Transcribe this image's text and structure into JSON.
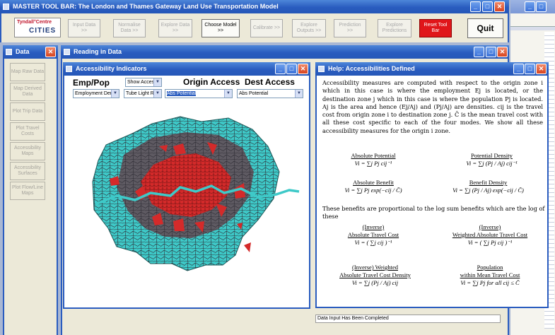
{
  "master": {
    "title": "MASTER TOOL BAR: The London and Thames Gateway Land Use Transportation Model",
    "logo_top": "Tyndall°Centre",
    "logo_bottom": "CITIES",
    "buttons": [
      "Input Data >>",
      "Normalise Data >>",
      "Explore Data >>",
      "Choose Model >>",
      "Calibrate >>",
      "Explore Outputs >>",
      "Prediction >>",
      "Explore Predictions"
    ],
    "reset": "Reset Tool Bar",
    "quit": "Quit"
  },
  "data_panel": {
    "title": "Data",
    "buttons": [
      "Map Raw Data",
      "Map Derived Data",
      "Plot Trip Data",
      "Plot Travel Costs",
      "Accessibility Maps",
      "Accessibility Surfaces",
      "Plot Flow/Line Maps"
    ]
  },
  "reading": {
    "title": "Reading in Data",
    "status": "Data Input Has Been Completed"
  },
  "access": {
    "title": "Accessibility Indicators",
    "emp_pop": "Emp/Pop",
    "origin": "Origin Access",
    "dest": "Dest Access",
    "sel_show": "Show Access",
    "sel_emp": "Employment Dens",
    "sel_mode": "Tube Light Ra",
    "sel_origin": "Abs Potential",
    "sel_dest": "Abs Potential"
  },
  "help": {
    "title": "Help: Accessibilities Defined",
    "intro": "Accessibility measures are computed with respect to the origin zone i which in this case is where the employment Ej is located, or the destination zone j which in this case is where the population Pj is located. Aj is the area and hence (Ej/Aj) and (Pj/Aj) are densities. cij is the travel cost from origin zone i to destination zone j. C̄ is the mean travel cost with all these cost specific to each of the four modes. We show all these accessibility measures for the origin i zone.",
    "mid": "These benefits are proportional to the log sum benefits which are the log of these",
    "f": [
      {
        "h": "Absolute Potential",
        "e": "Vi = ∑j Pj cij⁻¹"
      },
      {
        "h": "Potential Density",
        "e": "Vi = ∑j (Pj / Aj) cij⁻¹"
      },
      {
        "h": "Absolute Benefit",
        "e": "Vi = ∑j Pj exp(−cij / C̄)"
      },
      {
        "h": "Benefit Density",
        "e": "Vi = ∑j (Pj / Aj) exp(−cij / C̄)"
      },
      {
        "h": "(Inverse)",
        "h2": "Absolute Travel Cost",
        "e": "Vi = ( ∑j cij )⁻¹"
      },
      {
        "h": "(Inverse)",
        "h2": "Weighted Absolute Travel Cost",
        "e": "Vi = ( ∑j Pj cij )⁻¹"
      },
      {
        "h": "(Inverse) Weighted",
        "h2": "Absolute Travel Cost Density",
        "e": "Vi = ∑j (Pj / Aj) cij"
      },
      {
        "h": "Population",
        "h2": "within Mean Travel Cost",
        "e": "Vi = ∑j Pj  for all cij ≤ C̄"
      }
    ]
  },
  "colors": {
    "title": "#2a5cbf",
    "teal": "#3ec9c8",
    "red": "#d42a2a",
    "grey": "#5e5a62",
    "reset": "#e0161a"
  }
}
